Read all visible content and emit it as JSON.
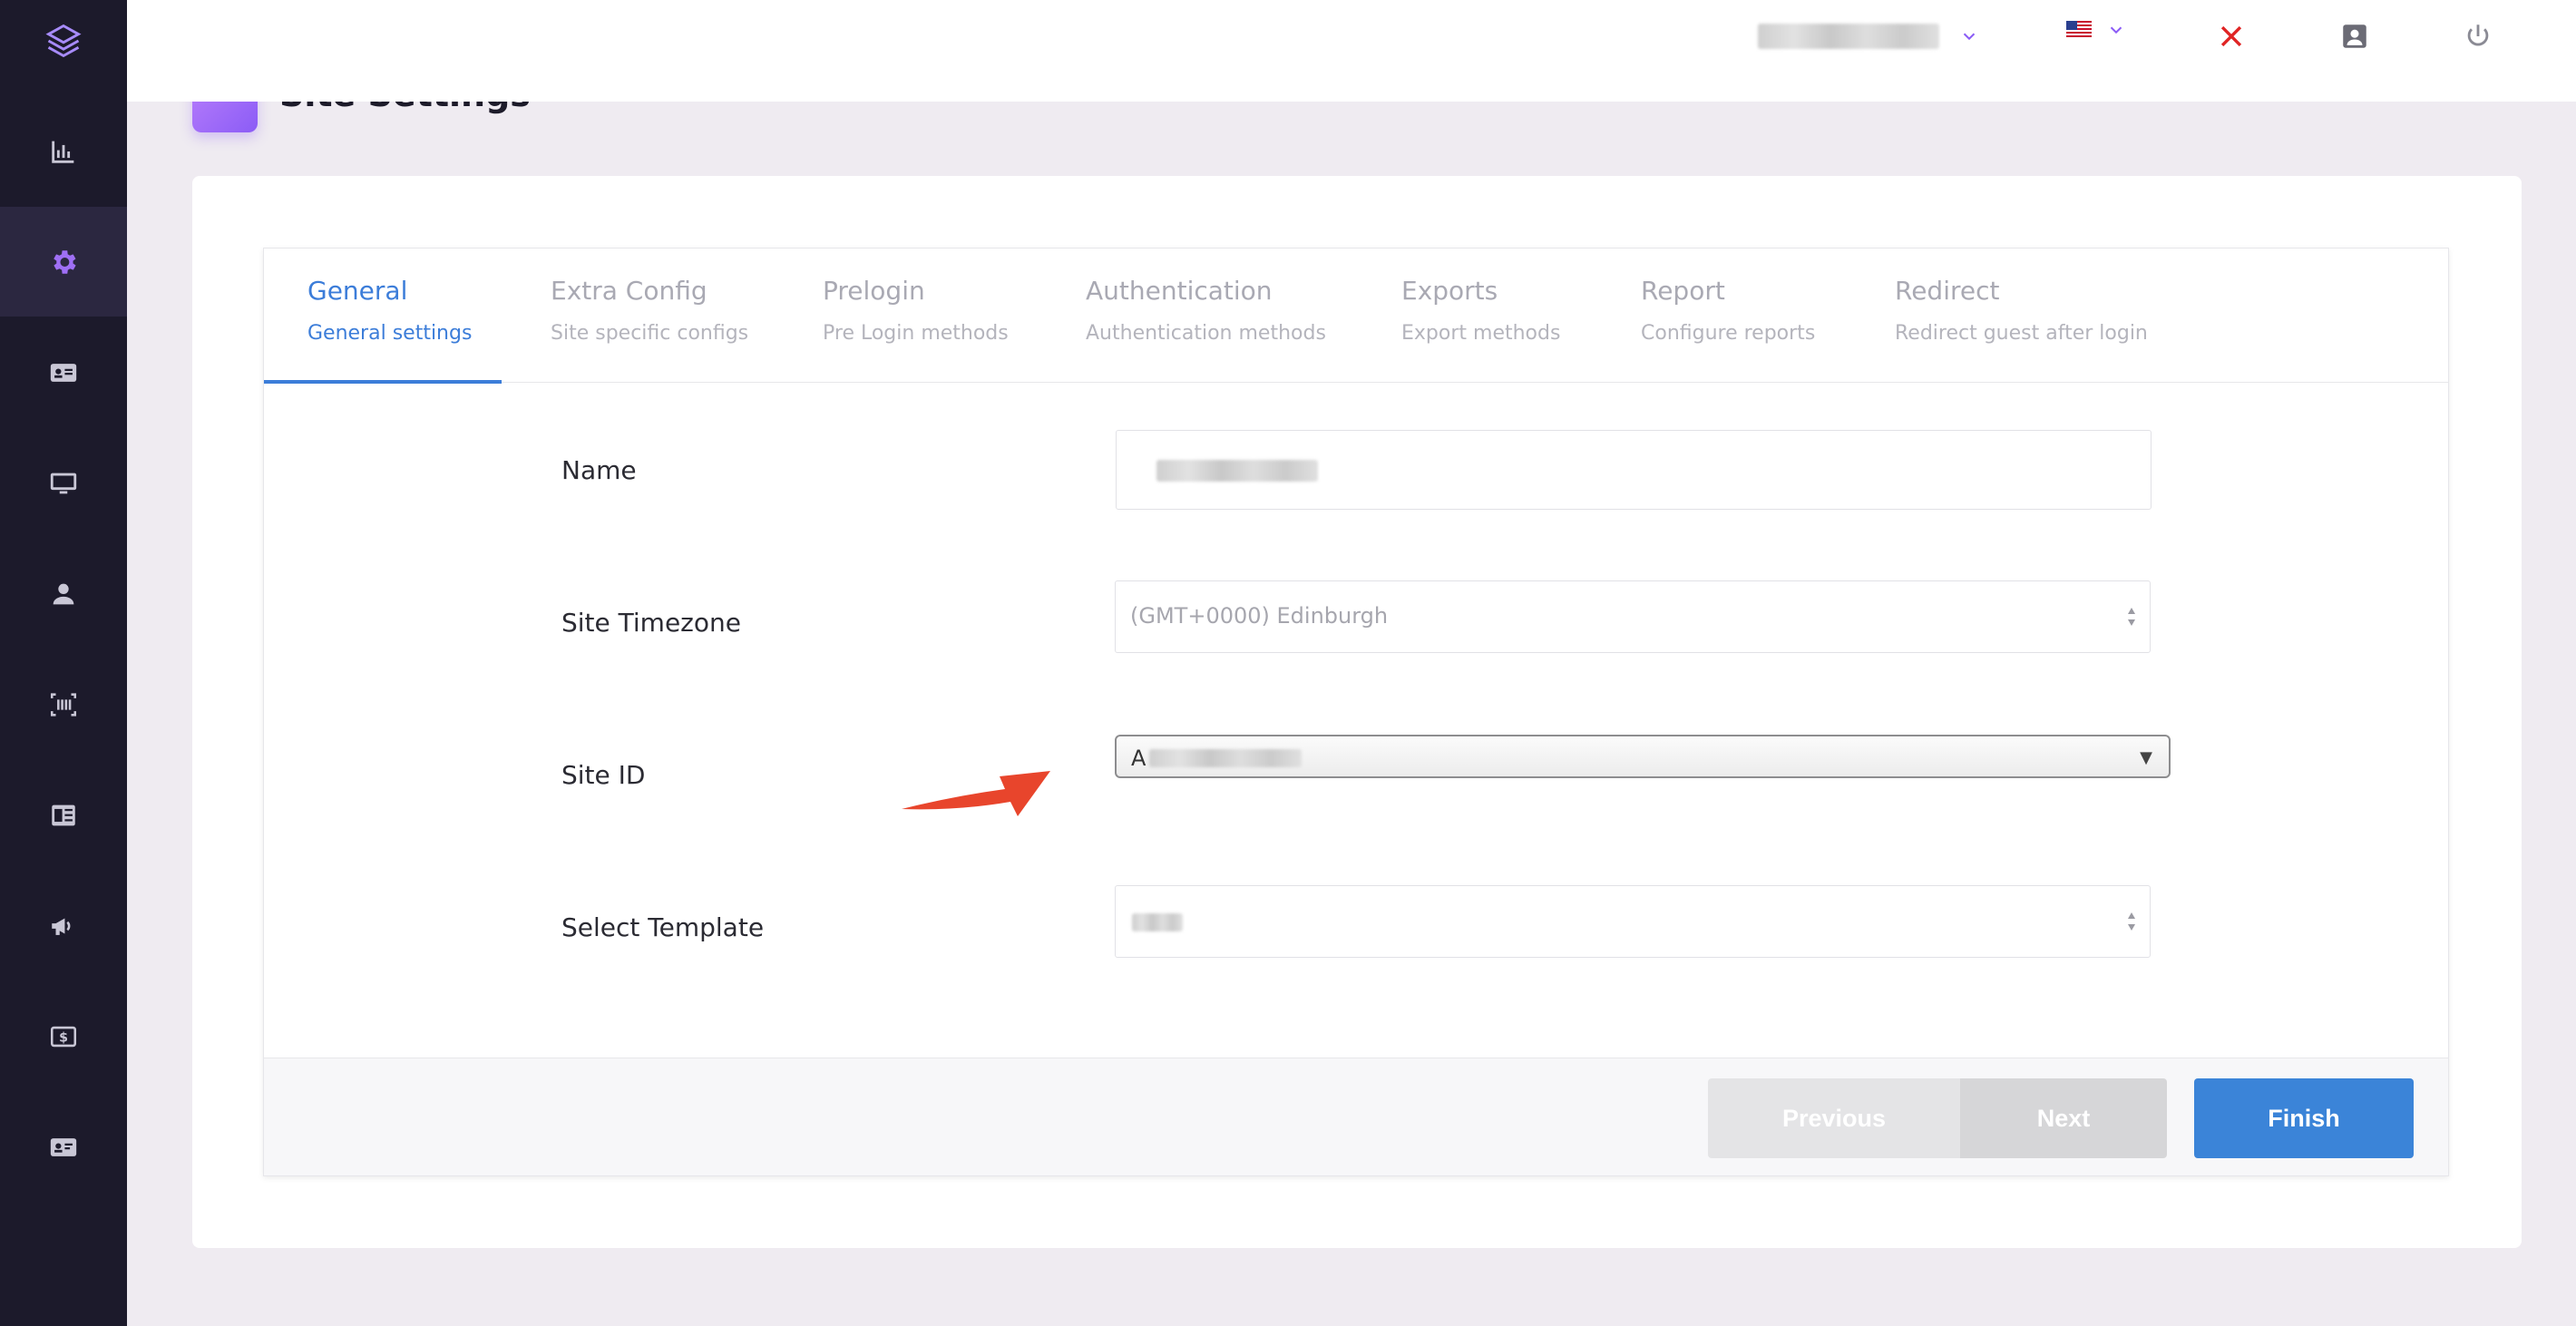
{
  "topbar": {
    "user_label": "",
    "language_flag": "us-flag"
  },
  "page": {
    "title": "Site Settings"
  },
  "tabs": [
    {
      "title": "General",
      "subtitle": "General settings",
      "active": true
    },
    {
      "title": "Extra Config",
      "subtitle": "Site specific configs"
    },
    {
      "title": "Prelogin",
      "subtitle": "Pre Login methods"
    },
    {
      "title": "Authentication",
      "subtitle": "Authentication methods"
    },
    {
      "title": "Exports",
      "subtitle": "Export methods"
    },
    {
      "title": "Report",
      "subtitle": "Configure reports"
    },
    {
      "title": "Redirect",
      "subtitle": "Redirect guest after login"
    }
  ],
  "form": {
    "name_label": "Name",
    "name_value": "",
    "timezone_label": "Site Timezone",
    "timezone_value": "(GMT+0000) Edinburgh",
    "site_id_label": "Site ID",
    "site_id_value": "A",
    "template_label": "Select Template",
    "template_value": ""
  },
  "buttons": {
    "previous": "Previous",
    "next": "Next",
    "finish": "Finish"
  },
  "colors": {
    "sidebar_bg": "#1c1a2b",
    "accent_purple": "#8b5cf6",
    "tab_active": "#3c7dd9",
    "finish_button": "#3b84d8",
    "close_red": "#e02424",
    "annotation_arrow": "#e8452c"
  },
  "sidebar_icons": [
    "layers-icon",
    "bar-chart-icon",
    "gear-icon",
    "id-card-icon",
    "monitor-icon",
    "user-icon",
    "barcode-icon",
    "newspaper-icon",
    "megaphone-icon",
    "dollar-icon",
    "contact-card-icon"
  ]
}
